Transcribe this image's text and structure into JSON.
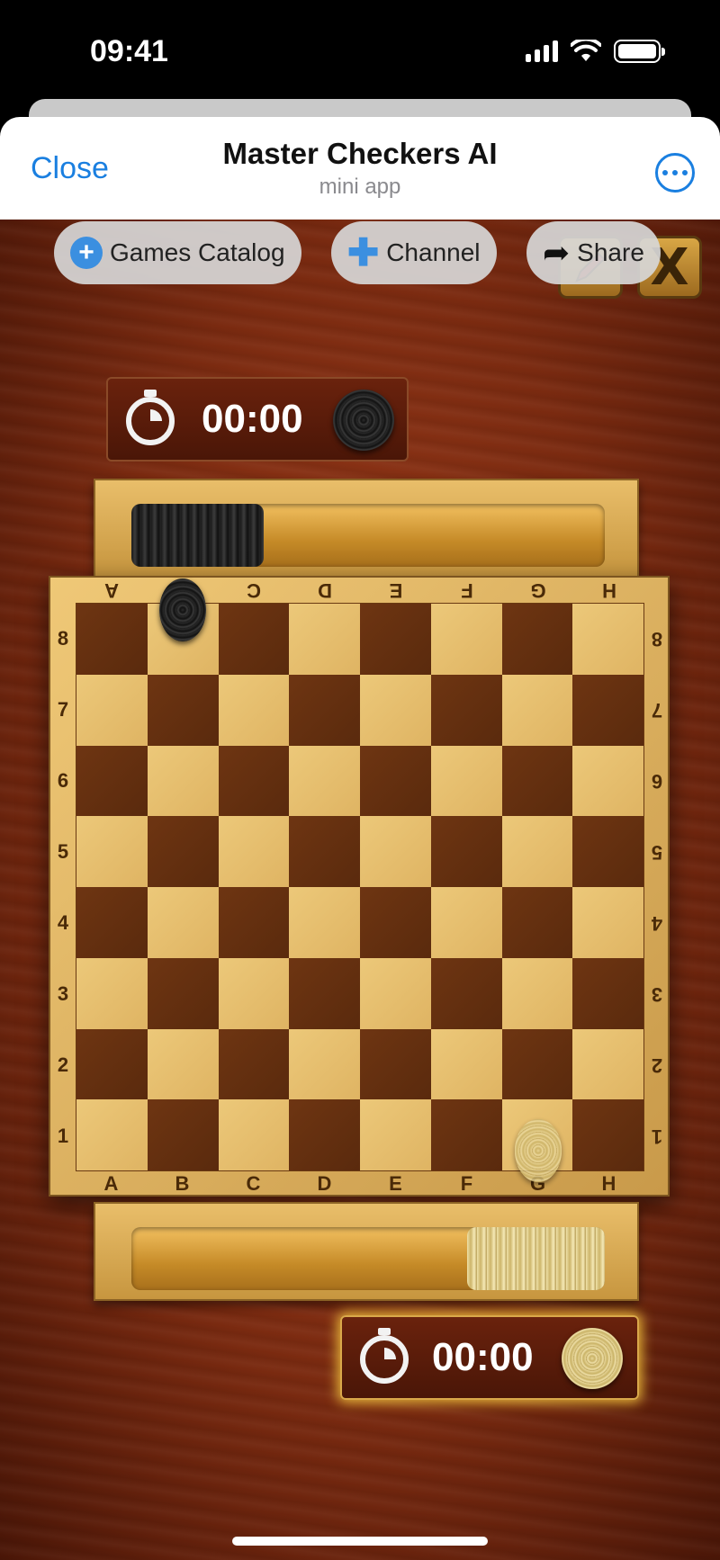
{
  "status_bar": {
    "time": "09:41"
  },
  "header": {
    "close_label": "Close",
    "title": "Master Checkers AI",
    "subtitle": "mini app",
    "more_icon": "ellipsis-circle-icon"
  },
  "toolbar": {
    "games_catalog_label": "Games Catalog",
    "channel_label": "Channel",
    "share_label": "Share"
  },
  "corner_buttons": {
    "close_glyph": "X"
  },
  "timers": {
    "top": {
      "time": "00:00",
      "piece": "dark"
    },
    "bottom": {
      "time": "00:00",
      "piece": "light",
      "active": true
    }
  },
  "trays": {
    "top": {
      "captured_dark_fraction": 0.28
    },
    "bottom": {
      "captured_light_fraction": 0.29
    }
  },
  "board": {
    "files": [
      "A",
      "B",
      "C",
      "D",
      "E",
      "F",
      "G",
      "H"
    ],
    "ranks": [
      "8",
      "7",
      "6",
      "5",
      "4",
      "3",
      "2",
      "1"
    ],
    "pieces": [
      {
        "color": "dark",
        "square": "B8",
        "tilted": true
      },
      {
        "color": "light",
        "square": "G1",
        "tilted": true
      }
    ]
  },
  "colors": {
    "accent_blue": "#1a7fe0",
    "wood_bg": "#7a2a10",
    "dark_square": "#6e3512",
    "light_square": "#ecc879",
    "active_glow": "#e8b83a"
  }
}
